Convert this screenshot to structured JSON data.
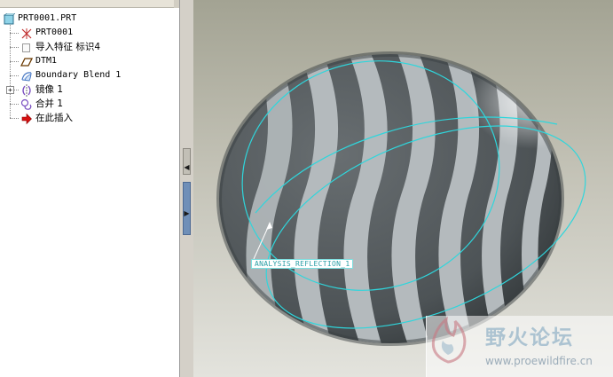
{
  "model_tree": {
    "root": "PRT0001.PRT",
    "items": [
      {
        "label": "PRT0001",
        "icon": "coordinate-system-icon"
      },
      {
        "label": "导入特征 标识4",
        "icon": "import-feature-icon"
      },
      {
        "label": "DTM1",
        "icon": "datum-plane-icon"
      },
      {
        "label": "Boundary Blend 1",
        "icon": "boundary-blend-icon"
      },
      {
        "label": "镜像 1",
        "icon": "mirror-icon"
      },
      {
        "label": "合并 1",
        "icon": "merge-icon"
      },
      {
        "label": "在此插入",
        "icon": "insert-here-arrow-icon"
      }
    ]
  },
  "viewport": {
    "analysis_label": "ANALYSIS_REFLECTION_1",
    "watermark": {
      "title": "野火论坛",
      "url": "www.proewildfire.cn"
    }
  },
  "colors": {
    "curve_cyan": "#2fd6dc",
    "body_dark": "#4f5558",
    "stripe_light": "#b6bcbf",
    "insert_arrow": "#d81010"
  }
}
